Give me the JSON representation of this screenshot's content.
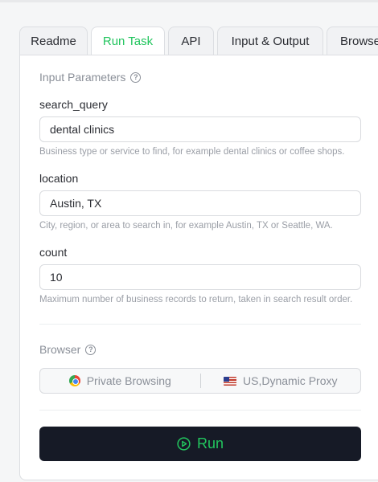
{
  "tabs": [
    {
      "label": "Readme",
      "active": false
    },
    {
      "label": "Run Task",
      "active": true
    },
    {
      "label": "API",
      "active": false
    },
    {
      "label": "Input & Output",
      "active": false
    },
    {
      "label": "Browse",
      "active": false
    }
  ],
  "input_parameters": {
    "title": "Input Parameters",
    "fields": [
      {
        "label": "search_query",
        "value": "dental clinics",
        "hint": "Business type or service to find, for example dental clinics or coffee shops."
      },
      {
        "label": "location",
        "value": "Austin, TX",
        "hint": "City, region, or area to search in, for example Austin, TX or Seattle, WA."
      },
      {
        "label": "count",
        "value": "10",
        "hint": "Maximum number of business records to return, taken in search result order."
      }
    ]
  },
  "browser": {
    "title": "Browser",
    "mode": "Private Browsing",
    "proxy": "US,Dynamic Proxy"
  },
  "run_button": {
    "label": "Run"
  },
  "colors": {
    "accent": "#22c55e",
    "button_bg": "#161a26"
  }
}
